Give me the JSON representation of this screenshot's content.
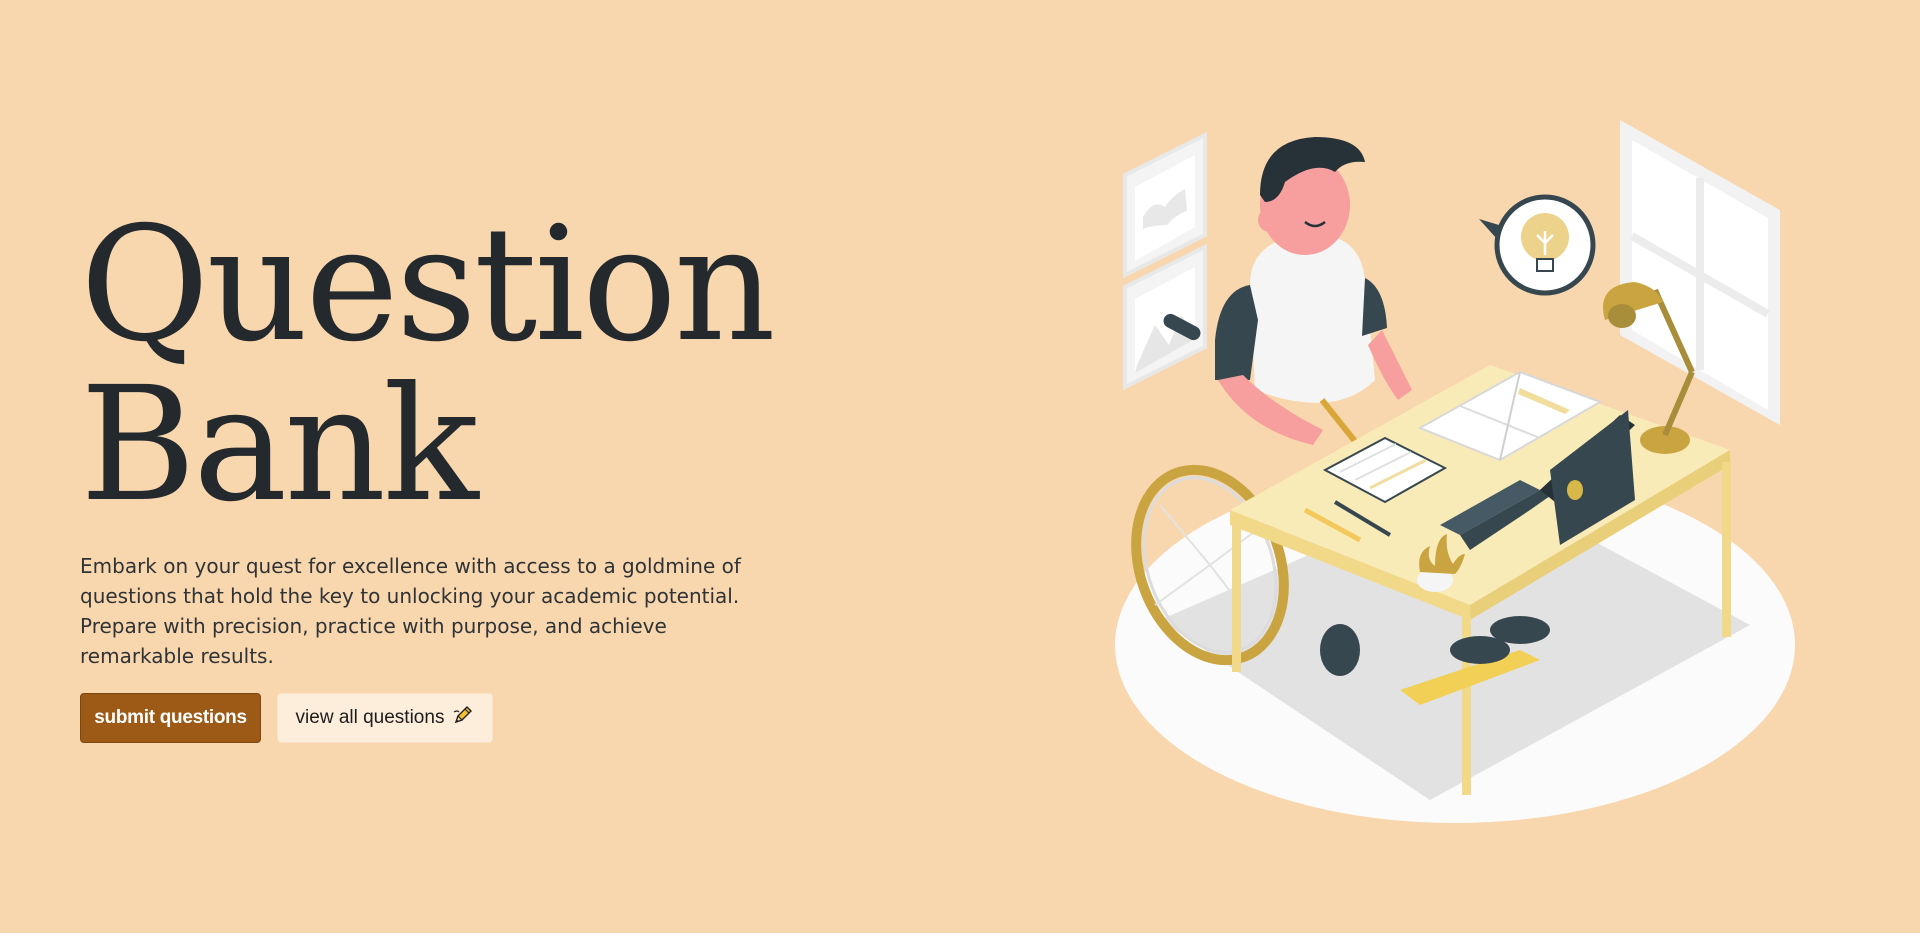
{
  "hero": {
    "title_line1": "Question",
    "title_line2": "Bank",
    "description": "Embark on your quest for excellence with access to a goldmine of questions that hold the key to unlocking your academic potential. Prepare with precision, practice with purpose, and achieve remarkable results.",
    "submit_label": "submit questions",
    "view_all_label": "view all questions",
    "view_all_icon": "pencil-icon"
  },
  "illustration": {
    "description_icon": "student-in-wheelchair-at-desk-illustration"
  },
  "colors": {
    "background": "#f9d7ae",
    "primary_button": "#9c5a16",
    "secondary_button": "#fdeedc",
    "heading_text": "#24292d"
  }
}
